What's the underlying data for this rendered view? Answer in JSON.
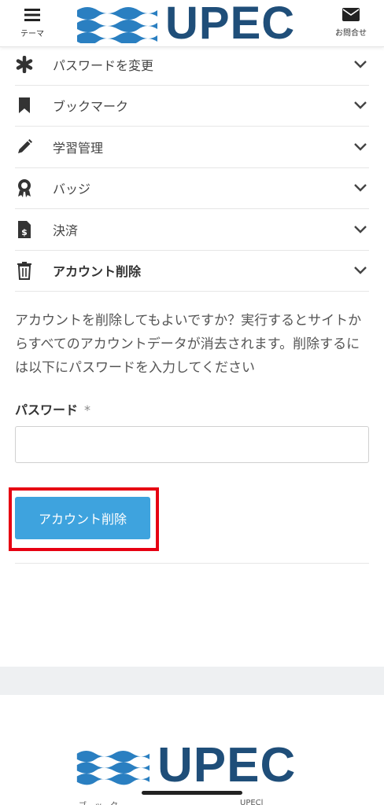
{
  "header": {
    "theme_label": "テーマ",
    "contact_label": "お問合せ",
    "logo_text": "UPEC",
    "icons": {
      "left": "hamburger-menu-icon",
      "right": "envelope-icon"
    }
  },
  "menu": {
    "items": [
      {
        "label": "パスワードを変更",
        "icon": "asterisk-icon"
      },
      {
        "label": "ブックマーク",
        "icon": "bookmark-icon"
      },
      {
        "label": "学習管理",
        "icon": "pencil-icon"
      },
      {
        "label": "バッジ",
        "icon": "award-badge-icon"
      },
      {
        "label": "決済",
        "icon": "invoice-dollar-icon"
      },
      {
        "label": "アカウント削除",
        "icon": "trash-icon"
      }
    ]
  },
  "delete_account": {
    "description": "アカウントを削除してもよいですか？実行するとサイトからすべてのアカウントデータが消去されます。削除するには以下にパスワードを入力してください",
    "password_label": "パスワード",
    "required_mark": "*",
    "password_value": "",
    "button_label": "アカウント削除"
  },
  "footer": {
    "logo_text": "UPEC",
    "fragment_left": "ブ　ッ　ク",
    "fragment_right": "UPECl"
  },
  "colors": {
    "brand_blue": "#1f4e79",
    "wave_blue": "#2a7fc1",
    "button_blue": "#3ea3de",
    "highlight_red": "#e60012"
  }
}
